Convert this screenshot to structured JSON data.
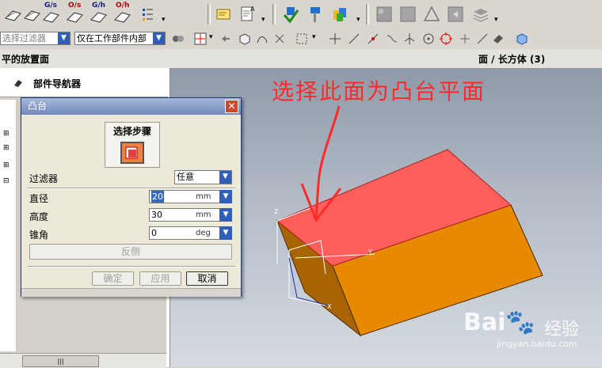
{
  "toolbar_top": {
    "items": [
      {
        "label": "",
        "icon": "sketch-icon"
      },
      {
        "label": "",
        "icon": "sketch-icon"
      },
      {
        "label": "G/s",
        "icon": "curve-g-icon"
      },
      {
        "label": "O/s",
        "icon": "curve-o-icon"
      },
      {
        "label": "G/h",
        "icon": "curve-gh-icon"
      },
      {
        "label": "O/h",
        "icon": "curve-oh-icon"
      }
    ]
  },
  "toolbar_select": {
    "filter_combo": "选择过滤器",
    "scope_combo": "仅在工作部件内部"
  },
  "status_bar": {
    "prompt": "平的放置面",
    "selection": "面 / 长方体 (3)"
  },
  "navigator": {
    "title": "部件导航器"
  },
  "annotation": {
    "text": "选择此面为凸台平面",
    "color": "#ff2a2a"
  },
  "model": {
    "axis_x": "X",
    "axis_y": "Y",
    "axis_z": "Z"
  },
  "dialog": {
    "title": "凸台",
    "step_label": "选择步骤",
    "filter_label": "过滤器",
    "filter_value": "任意",
    "fields": [
      {
        "label": "直径",
        "value": "20",
        "unit": "mm"
      },
      {
        "label": "高度",
        "value": "30",
        "unit": "mm"
      },
      {
        "label": "锥角",
        "value": "0",
        "unit": "deg"
      }
    ],
    "reverse_button": "反侧",
    "ok_button": "确定",
    "apply_button": "应用",
    "cancel_button": "取消"
  },
  "watermark": {
    "brand": "Bai",
    "brand2": "经验",
    "url": "jingyan.baidu.com"
  },
  "colors": {
    "top_face": "#ff5f5a",
    "side_face": "#e88a00",
    "front_face": "#b36a00"
  }
}
